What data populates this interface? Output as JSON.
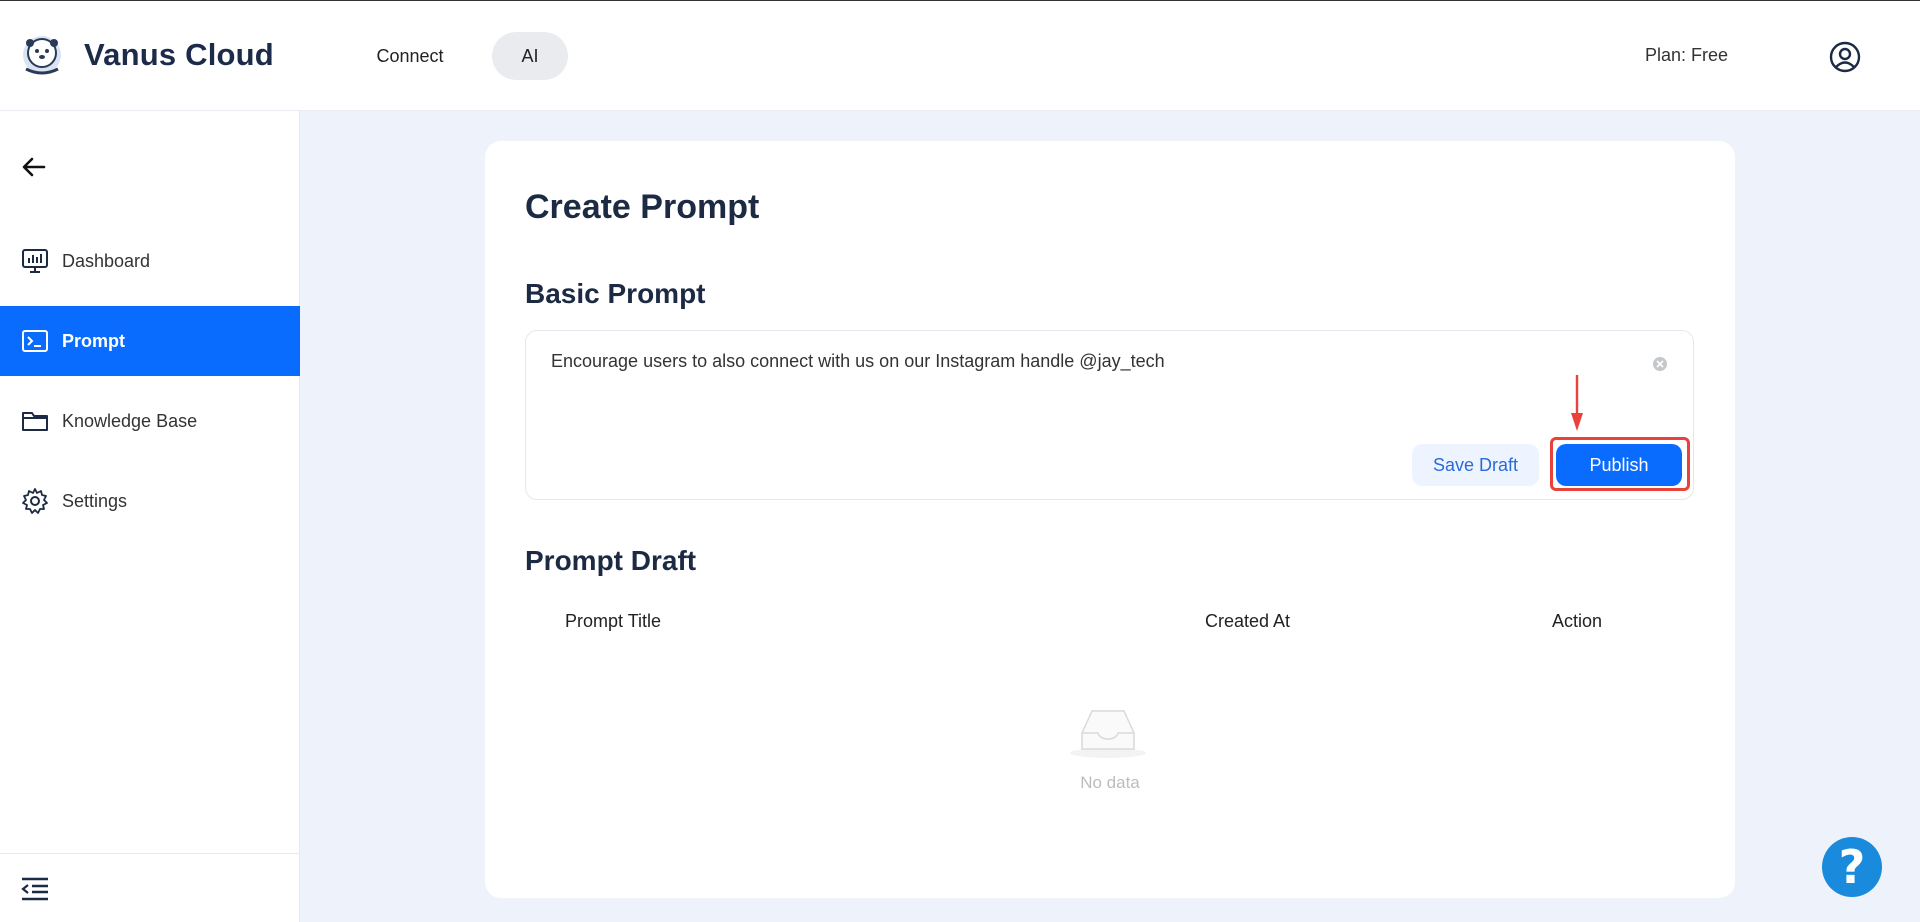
{
  "header": {
    "brand": "Vanus Cloud",
    "nav": {
      "connect": "Connect",
      "ai": "AI"
    },
    "plan": "Plan: Free"
  },
  "sidebar": {
    "items": [
      {
        "label": "Dashboard",
        "icon": "dashboard-icon"
      },
      {
        "label": "Prompt",
        "icon": "terminal-icon",
        "active": true
      },
      {
        "label": "Knowledge Base",
        "icon": "folder-icon"
      },
      {
        "label": "Settings",
        "icon": "gear-icon"
      }
    ]
  },
  "main": {
    "title": "Create Prompt",
    "basic": {
      "title": "Basic Prompt",
      "text": "Encourage users to also connect with us on our Instagram handle @jay_tech",
      "save_draft": "Save Draft",
      "publish": "Publish"
    },
    "draft": {
      "title": "Prompt Draft",
      "columns": [
        "Prompt Title",
        "Created At",
        "Action"
      ],
      "empty": "No data"
    }
  },
  "help": {
    "label": "?"
  },
  "colors": {
    "primary": "#0a6cff",
    "highlight": "#e8423a",
    "text": "#1c2a44"
  }
}
